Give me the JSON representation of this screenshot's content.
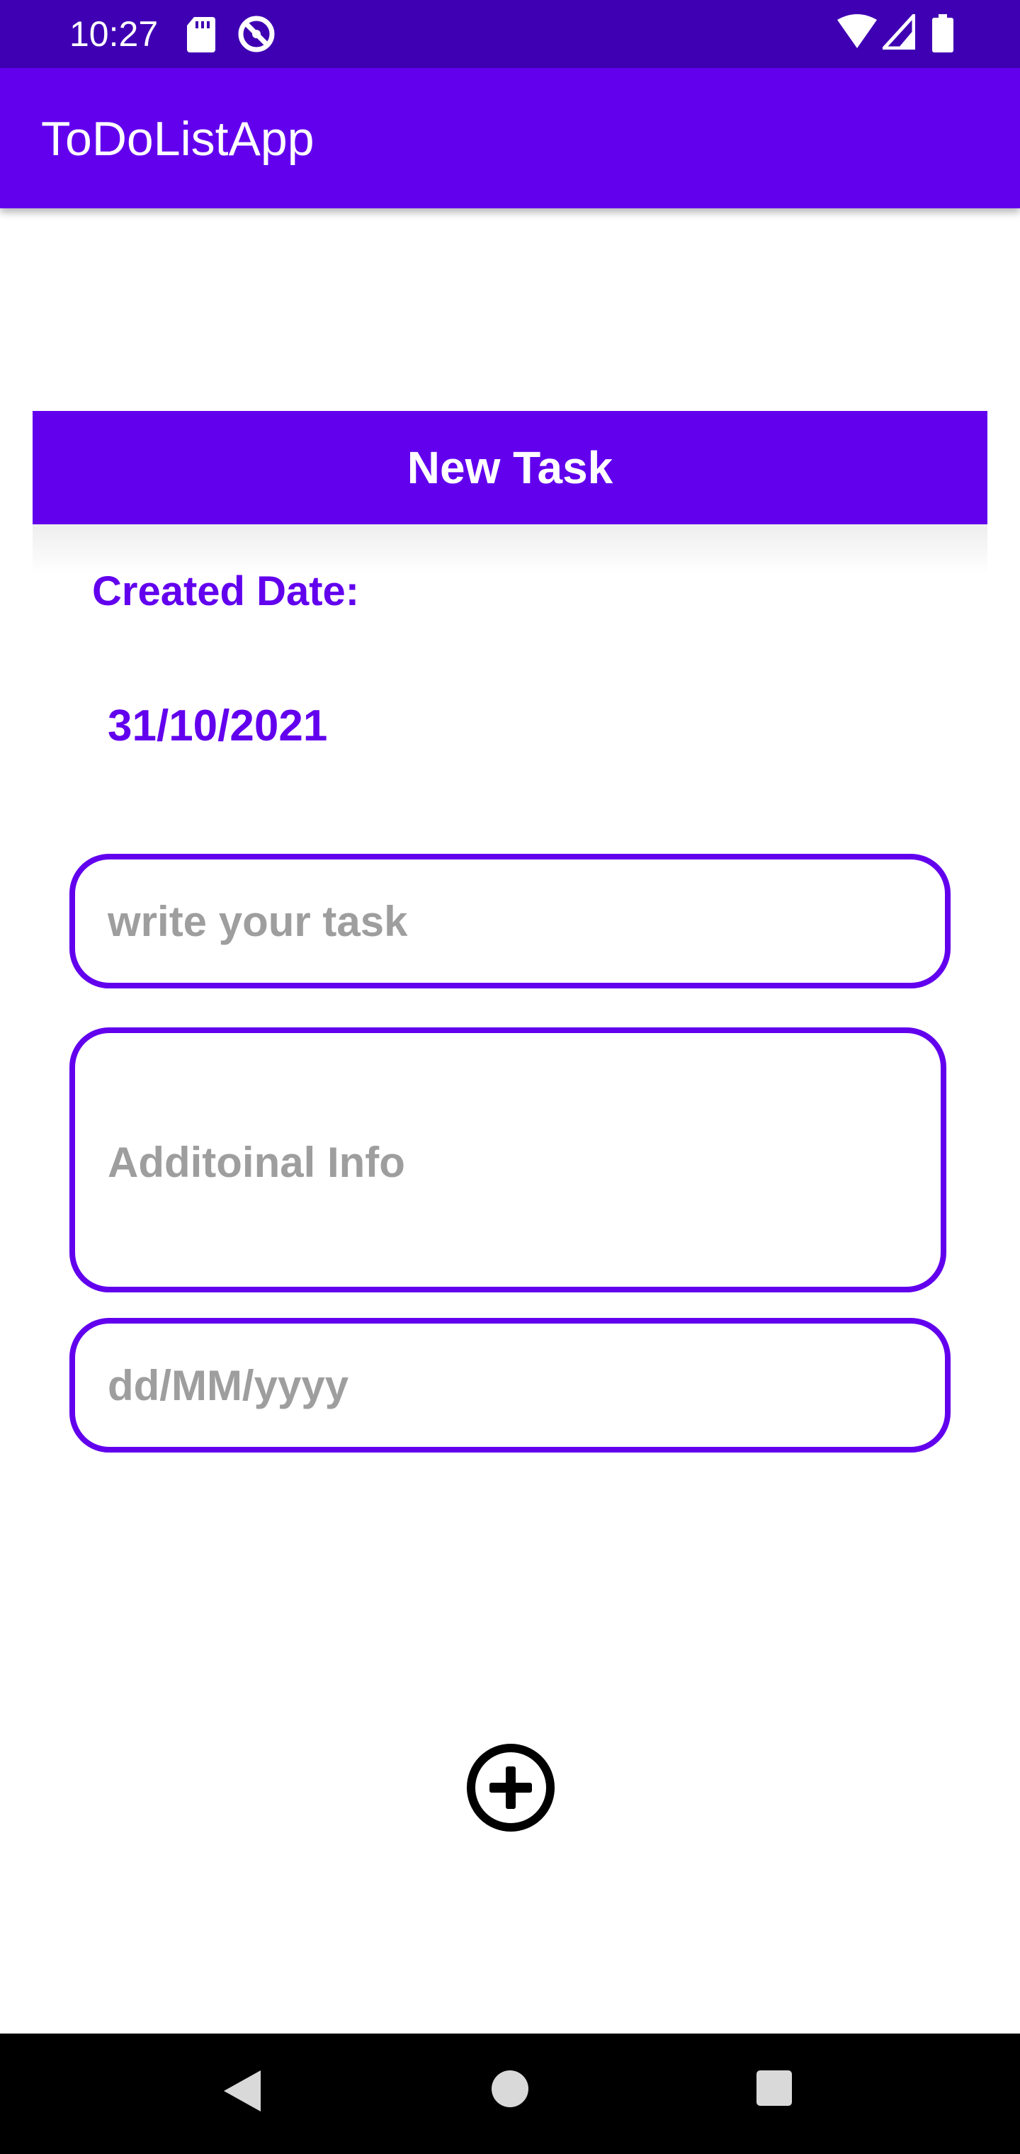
{
  "status_bar": {
    "time": "10:27",
    "icons": [
      "sd-card-icon",
      "data-saver-icon",
      "wifi-icon",
      "signal-icon",
      "battery-icon"
    ]
  },
  "app_bar": {
    "title": "ToDoListApp"
  },
  "form": {
    "header": "New Task",
    "created_label": "Created Date:",
    "created_value": "31/10/2021",
    "task_field": {
      "placeholder": "write your task",
      "value": ""
    },
    "info_field": {
      "placeholder": "Additoinal Info",
      "value": ""
    },
    "date_field": {
      "placeholder": "dd/MM/yyyy",
      "value": ""
    },
    "add_button_icon": "add-circle-icon"
  },
  "nav_bar": {
    "buttons": [
      "back-icon",
      "home-icon",
      "recents-icon"
    ]
  },
  "colors": {
    "primary": "#6200EE",
    "primary_dark": "#3F00B3",
    "hint": "#9E9E9E"
  }
}
